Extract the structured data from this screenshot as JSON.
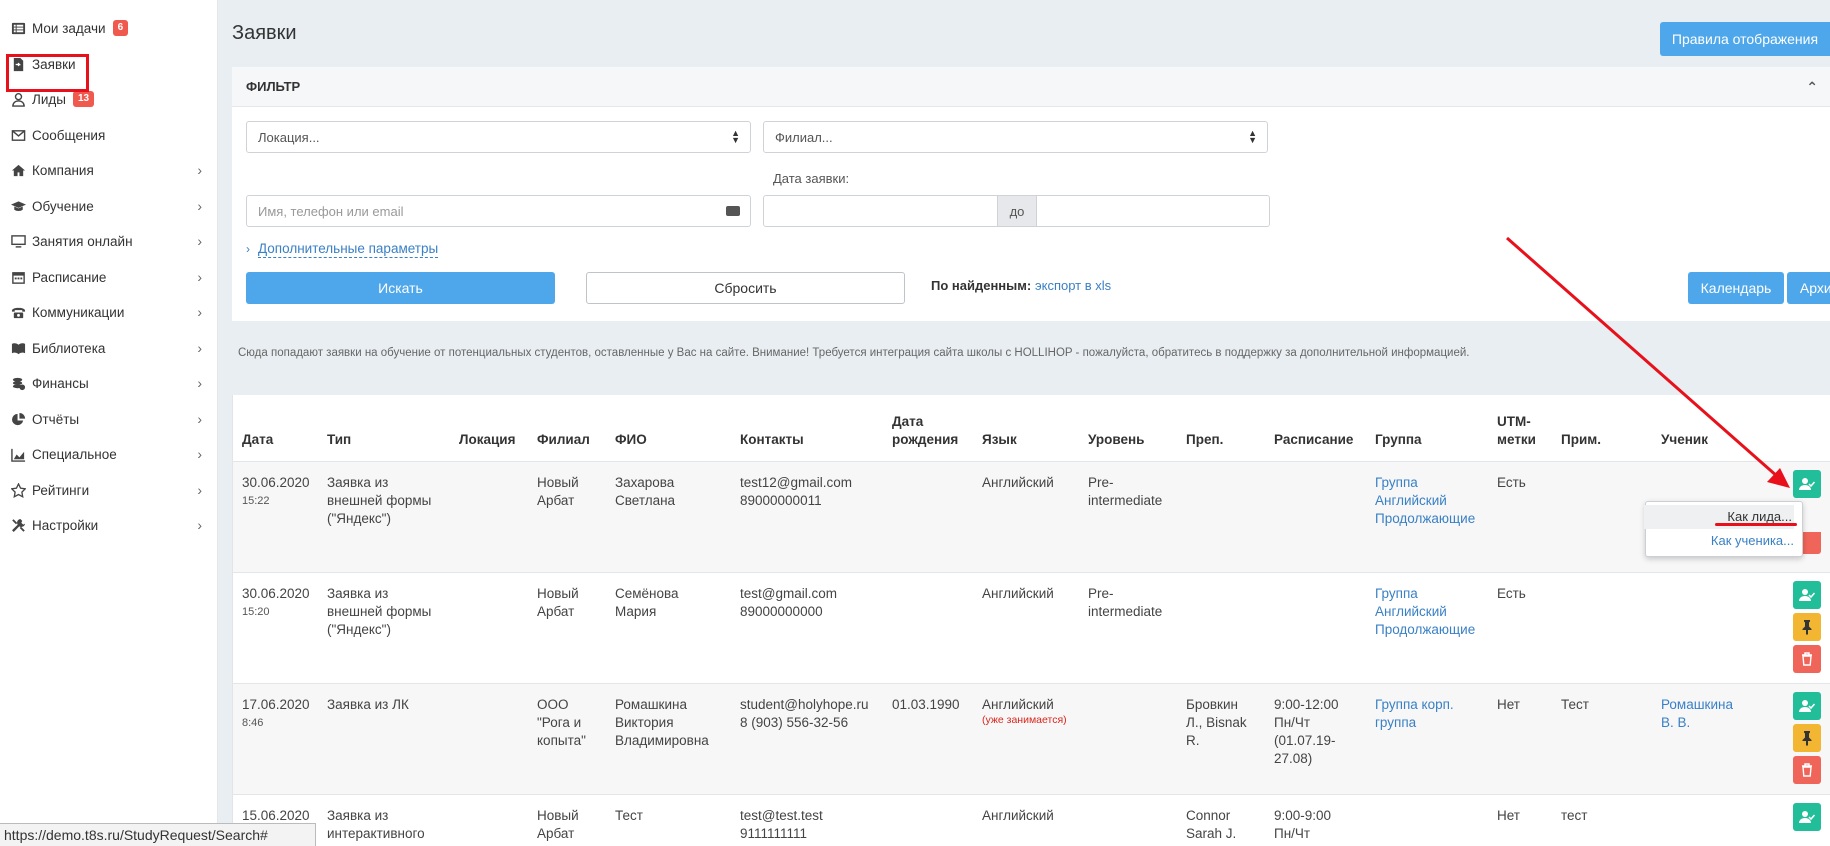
{
  "sidebar": {
    "items": [
      {
        "label": "Мои задачи",
        "badge": "6",
        "icon": "tasks-icon"
      },
      {
        "label": "Заявки",
        "icon": "request-icon"
      },
      {
        "label": "Лиды",
        "badge": "13",
        "icon": "user-icon"
      },
      {
        "label": "Сообщения",
        "icon": "envelope-icon"
      },
      {
        "label": "Компания",
        "icon": "home-icon"
      },
      {
        "label": "Обучение",
        "icon": "graduation-cap-icon"
      },
      {
        "label": "Занятия онлайн",
        "icon": "monitor-icon"
      },
      {
        "label": "Расписание",
        "icon": "calendar-icon"
      },
      {
        "label": "Коммуникации",
        "icon": "phone-icon"
      },
      {
        "label": "Библиотека",
        "icon": "book-icon"
      },
      {
        "label": "Финансы",
        "icon": "coins-icon"
      },
      {
        "label": "Отчёты",
        "icon": "pie-chart-icon"
      },
      {
        "label": "Специальное",
        "icon": "area-chart-icon"
      },
      {
        "label": "Рейтинги",
        "icon": "star-icon"
      },
      {
        "label": "Настройки",
        "icon": "tools-icon"
      }
    ]
  },
  "page": {
    "title": "Заявки",
    "rules_button": "Правила отображения"
  },
  "filter": {
    "header": "ФИЛЬТР",
    "location_placeholder": "Локация...",
    "branch_placeholder": "Филиал...",
    "date_label": "Дата заявки:",
    "search_placeholder": "Имя, телефон или email",
    "date_to": "до",
    "advanced_link": "Дополнительные параметры",
    "search_button": "Искать",
    "reset_button": "Сбросить",
    "found_label": "По найденным:",
    "export_link": "экспорт в xls",
    "calendar_button": "Календарь",
    "archive_button": "Архив"
  },
  "info_text": "Сюда попадают заявки на обучение от потенциальных студентов, оставленные у Вас на сайте. Внимание! Требуется интеграция сайта школы с HOLLIHOP - пожалуйста, обратитесь в поддержку за дополнительной информацией.",
  "table": {
    "headers": {
      "date": "Дата",
      "type": "Тип",
      "location": "Локация",
      "branch": "Филиал",
      "fio": "ФИО",
      "contacts": "Контакты",
      "birth_1": "Дата",
      "birth_2": "рождения",
      "language": "Язык",
      "level": "Уровень",
      "teacher": "Преп.",
      "schedule": "Расписание",
      "group": "Группа",
      "utm_1": "UTM-",
      "utm_2": "метки",
      "note": "Прим.",
      "student": "Ученик"
    },
    "rows": [
      {
        "date": "30.06.2020",
        "time": "15:22",
        "type": [
          "Заявка из",
          "внешней формы",
          "(\"Яндекс\")"
        ],
        "branch": [
          "Новый",
          "Арбат"
        ],
        "fio": [
          "Захарова",
          "Светлана"
        ],
        "contacts": [
          "test12@gmail.com",
          "89000000011"
        ],
        "language": "Английский",
        "level": [
          "Pre-",
          "intermediate"
        ],
        "group": [
          "Группа",
          "Английский",
          "Продолжающие"
        ],
        "utm": "Есть"
      },
      {
        "date": "30.06.2020",
        "time": "15:20",
        "type": [
          "Заявка из",
          "внешней формы",
          "(\"Яндекс\")"
        ],
        "branch": [
          "Новый",
          "Арбат"
        ],
        "fio": [
          "Семёнова",
          "Мария"
        ],
        "contacts": [
          "test@gmail.com",
          "89000000000"
        ],
        "language": "Английский",
        "level": [
          "Pre-",
          "intermediate"
        ],
        "group": [
          "Группа",
          "Английский",
          "Продолжающие"
        ],
        "utm": "Есть"
      },
      {
        "date": "17.06.2020",
        "time": "8:46",
        "type": [
          "Заявка из ЛК"
        ],
        "branch": [
          "ООО",
          "\"Рога и",
          "копыта\""
        ],
        "fio": [
          "Ромашкина",
          "Виктория",
          "Владимировна"
        ],
        "contacts": [
          "student@holyhope.ru",
          "8 (903) 556-32-56"
        ],
        "birth": "01.03.1990",
        "language": "Английский",
        "language_note": "(уже занимается)",
        "teacher": [
          "Бровкин",
          "Л., Bisnak",
          "R."
        ],
        "schedule": [
          "9:00-12:00",
          "Пн/Чт",
          "(01.07.19-",
          "27.08)"
        ],
        "group": [
          "Группа корп.",
          "группа"
        ],
        "utm": "Нет",
        "note": "Тест",
        "student": [
          "Ромашкина",
          "В. В."
        ]
      },
      {
        "date": "15.06.2020",
        "time": "",
        "type": [
          "Заявка из",
          "интерактивного"
        ],
        "branch": [
          "Новый",
          "Арбат"
        ],
        "fio": [
          "Тест"
        ],
        "contacts": [
          "test@test.test",
          "9111111111"
        ],
        "language": "Английский",
        "teacher": [
          "Connor",
          "Sarah J."
        ],
        "schedule": [
          "9:00-9:00",
          "Пн/Чт"
        ],
        "utm": "Нет",
        "note": "тест"
      }
    ]
  },
  "dropdown": {
    "as_lead": "Как лида...",
    "as_student": "Как ученика..."
  },
  "status_url": "https://demo.t8s.ru/StudyRequest/Search#",
  "colors": {
    "primary": "#4ea7ea",
    "green": "#22bd99",
    "yellow": "#f2b632",
    "red": "#f0655a",
    "badge": "#f05a4e",
    "annotation": "#e8101a"
  }
}
